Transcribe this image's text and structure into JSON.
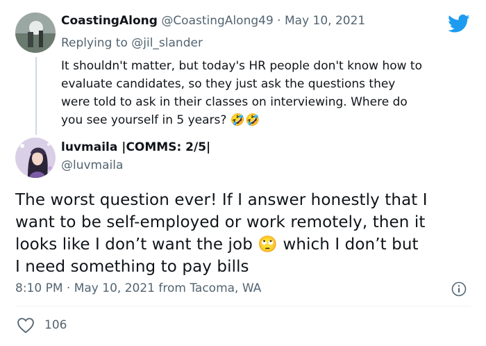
{
  "parent_tweet": {
    "display_name": "CoastingAlong",
    "handle": "@CoastingAlong49",
    "separator": "·",
    "date": "May 10, 2021",
    "replying_prefix": "Replying to",
    "replying_handle": "@jil_slander",
    "text_lines": [
      "It shouldn't matter, but today's HR people don't know how to",
      "evaluate candidates, so they just ask the questions they",
      "were told to ask in their classes on interviewing. Where do",
      "you see yourself in 5 years? 🤣🤣"
    ]
  },
  "main_tweet": {
    "display_name": "luvmaila |COMMS: 2/5|",
    "handle": "@luvmaila",
    "text_lines": [
      "The worst question ever! If I answer honestly that I",
      "want to be self-employed or work remotely, then it",
      "looks like I don’t want the job 🙄 which I don’t but",
      "I need something to pay bills"
    ],
    "meta": "8:10 PM · May 10, 2021 from Tacoma, WA",
    "like_count": "106"
  },
  "icons": {
    "brand": "twitter-bird-icon",
    "info": "info-icon",
    "like": "heart-icon"
  },
  "colors": {
    "twitter_blue": "#1d9bf0",
    "muted_text": "#536471",
    "text": "#0f1419",
    "reply_line": "#cfd9de"
  }
}
